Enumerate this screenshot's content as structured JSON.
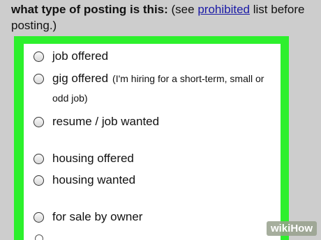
{
  "heading": {
    "question": "what type of posting is this:",
    "pre_link": "(see",
    "link": "prohibited",
    "post_link": "list before posting.)"
  },
  "options": [
    {
      "label": "job offered"
    },
    {
      "label": "gig offered",
      "note": "(I'm hiring for a short-term, small or",
      "note_cont": "odd job)"
    },
    {
      "label": "resume / job wanted"
    },
    {
      "label": "housing offered"
    },
    {
      "label": "housing wanted"
    },
    {
      "label": "for sale by owner"
    }
  ],
  "watermark": {
    "wiki": "wiki",
    "how": "How"
  },
  "colors": {
    "frame": "#2df02d",
    "link": "#1a1aa6",
    "background": "#cdcdcd"
  }
}
